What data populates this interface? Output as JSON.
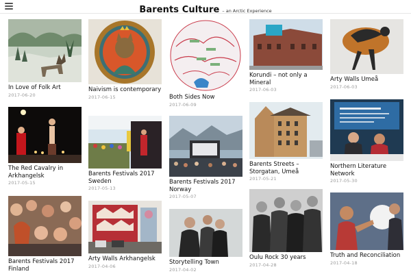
{
  "header": {
    "title": "Barents Culture",
    "tagline": "– an Arctic Experience"
  },
  "columns": [
    [
      {
        "title": "In Love of Folk Art",
        "date": "2017-06-20",
        "icon": "reindeer-painting-image"
      },
      {
        "title": "The Red Cavalry in Arkhangelsk",
        "date": "2017-05-15",
        "icon": "stage-performance-image"
      },
      {
        "title": "Barents Festivals 2017 Finland",
        "date": "",
        "icon": "crowd-image"
      }
    ],
    [
      {
        "title": "Naivism is contemporary",
        "date": "2017-06-15",
        "icon": "cat-portrait-image"
      },
      {
        "title": "Barents Festivals 2017 Sweden",
        "date": "2017-05-13",
        "icon": "festival-stage-image"
      },
      {
        "title": "Arty Walls Arkhangelsk",
        "date": "2017-04-06",
        "icon": "mural-wall-image"
      }
    ],
    [
      {
        "title": "Both Sides Now",
        "date": "2017-06-09",
        "icon": "circular-map-image"
      },
      {
        "title": "Barents Festivals 2017 Norway",
        "date": "2017-05-07",
        "icon": "outdoor-concert-image"
      },
      {
        "title": "Storytelling Town",
        "date": "2017-04-02",
        "icon": "band-portrait-image"
      }
    ],
    [
      {
        "title": "Korundi – not only a Mineral",
        "date": "2017-06-03",
        "icon": "brick-building-image"
      },
      {
        "title": "Barents Streets – Storgatan, Umeå",
        "date": "2017-05-21",
        "icon": "street-building-image"
      },
      {
        "title": "Oulu Rock 30 years",
        "date": "2017-04-28",
        "icon": "rock-band-image"
      }
    ],
    [
      {
        "title": "Arty Walls Umeå",
        "date": "2017-06-03",
        "icon": "wall-art-figure-image"
      },
      {
        "title": "Northern Literature Network",
        "date": "2017-05-30",
        "icon": "panel-discussion-image"
      },
      {
        "title": "Truth and Reconciliation",
        "date": "2017-04-18",
        "icon": "ritual-performance-image"
      }
    ]
  ],
  "colors": {
    "accent": "#222222",
    "date": "#999999"
  }
}
